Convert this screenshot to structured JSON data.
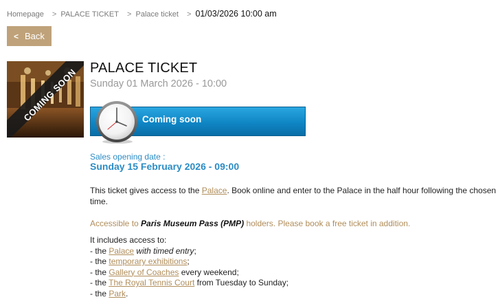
{
  "breadcrumb": {
    "items": [
      "Homepage",
      "PALACE TICKET",
      "Palace ticket"
    ],
    "separator": ">",
    "current": "01/03/2026 10:00 am"
  },
  "back_button": {
    "label": "Back",
    "icon": "chevron-left-icon"
  },
  "thumbnail": {
    "banner_text": "COMING SOON"
  },
  "ticket": {
    "title": "PALACE TICKET",
    "datetime": "Sunday 01 March 2026 - 10:00"
  },
  "status_banner": {
    "label": "Coming soon",
    "icon": "clock-icon",
    "color": "#1591d2"
  },
  "sales": {
    "label": "Sales opening date :",
    "date": "Sunday 15 February 2026 - 09:00"
  },
  "description": {
    "part1": "This ticket gives access to the ",
    "link": "Palace",
    "part2": ". Book online and enter to the Palace in the half hour following the chosen time."
  },
  "pmp": {
    "prefix": "Accessible to ",
    "bold": "Paris Museum Pass (PMP)",
    "suffix": " holders. Please book a free ticket in addition."
  },
  "includes": {
    "intro": "It includes access to:",
    "items": [
      {
        "prefix": "- the ",
        "link": "Palace",
        "suffix_italic": " with timed entry",
        "suffix": ";"
      },
      {
        "prefix": "- the ",
        "link": "temporary exhibitions",
        "suffix": ";"
      },
      {
        "prefix": "- the ",
        "link": "Gallery of Coaches",
        "suffix": " every weekend;"
      },
      {
        "prefix": "- the ",
        "link": "The Royal Tennis Court",
        "suffix": " from Tuesday to Sunday;"
      },
      {
        "prefix": "- the ",
        "link": "Park",
        "suffix": "."
      }
    ]
  },
  "colors": {
    "accent_gold": "#bfa27a",
    "link_gold": "#b08d5a",
    "sales_blue": "#2b8cc4"
  }
}
